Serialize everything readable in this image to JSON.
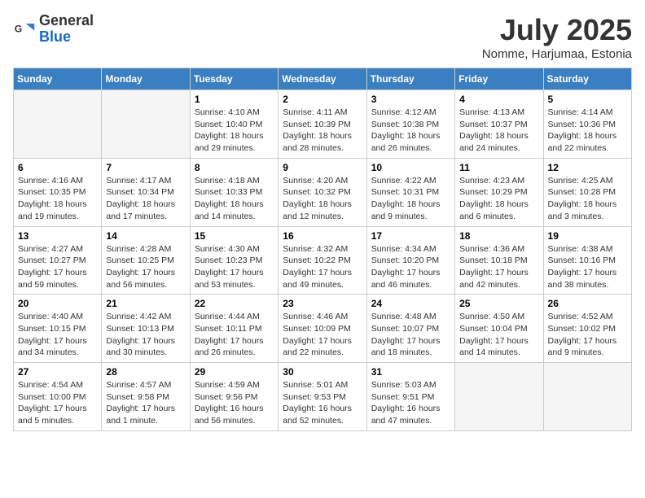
{
  "header": {
    "logo_general": "General",
    "logo_blue": "Blue",
    "month_year": "July 2025",
    "location": "Nomme, Harjumaa, Estonia"
  },
  "days_of_week": [
    "Sunday",
    "Monday",
    "Tuesday",
    "Wednesday",
    "Thursday",
    "Friday",
    "Saturday"
  ],
  "weeks": [
    [
      {
        "day": "",
        "info": ""
      },
      {
        "day": "",
        "info": ""
      },
      {
        "day": "1",
        "info": "Sunrise: 4:10 AM\nSunset: 10:40 PM\nDaylight: 18 hours\nand 29 minutes."
      },
      {
        "day": "2",
        "info": "Sunrise: 4:11 AM\nSunset: 10:39 PM\nDaylight: 18 hours\nand 28 minutes."
      },
      {
        "day": "3",
        "info": "Sunrise: 4:12 AM\nSunset: 10:38 PM\nDaylight: 18 hours\nand 26 minutes."
      },
      {
        "day": "4",
        "info": "Sunrise: 4:13 AM\nSunset: 10:37 PM\nDaylight: 18 hours\nand 24 minutes."
      },
      {
        "day": "5",
        "info": "Sunrise: 4:14 AM\nSunset: 10:36 PM\nDaylight: 18 hours\nand 22 minutes."
      }
    ],
    [
      {
        "day": "6",
        "info": "Sunrise: 4:16 AM\nSunset: 10:35 PM\nDaylight: 18 hours\nand 19 minutes."
      },
      {
        "day": "7",
        "info": "Sunrise: 4:17 AM\nSunset: 10:34 PM\nDaylight: 18 hours\nand 17 minutes."
      },
      {
        "day": "8",
        "info": "Sunrise: 4:18 AM\nSunset: 10:33 PM\nDaylight: 18 hours\nand 14 minutes."
      },
      {
        "day": "9",
        "info": "Sunrise: 4:20 AM\nSunset: 10:32 PM\nDaylight: 18 hours\nand 12 minutes."
      },
      {
        "day": "10",
        "info": "Sunrise: 4:22 AM\nSunset: 10:31 PM\nDaylight: 18 hours\nand 9 minutes."
      },
      {
        "day": "11",
        "info": "Sunrise: 4:23 AM\nSunset: 10:29 PM\nDaylight: 18 hours\nand 6 minutes."
      },
      {
        "day": "12",
        "info": "Sunrise: 4:25 AM\nSunset: 10:28 PM\nDaylight: 18 hours\nand 3 minutes."
      }
    ],
    [
      {
        "day": "13",
        "info": "Sunrise: 4:27 AM\nSunset: 10:27 PM\nDaylight: 17 hours\nand 59 minutes."
      },
      {
        "day": "14",
        "info": "Sunrise: 4:28 AM\nSunset: 10:25 PM\nDaylight: 17 hours\nand 56 minutes."
      },
      {
        "day": "15",
        "info": "Sunrise: 4:30 AM\nSunset: 10:23 PM\nDaylight: 17 hours\nand 53 minutes."
      },
      {
        "day": "16",
        "info": "Sunrise: 4:32 AM\nSunset: 10:22 PM\nDaylight: 17 hours\nand 49 minutes."
      },
      {
        "day": "17",
        "info": "Sunrise: 4:34 AM\nSunset: 10:20 PM\nDaylight: 17 hours\nand 46 minutes."
      },
      {
        "day": "18",
        "info": "Sunrise: 4:36 AM\nSunset: 10:18 PM\nDaylight: 17 hours\nand 42 minutes."
      },
      {
        "day": "19",
        "info": "Sunrise: 4:38 AM\nSunset: 10:16 PM\nDaylight: 17 hours\nand 38 minutes."
      }
    ],
    [
      {
        "day": "20",
        "info": "Sunrise: 4:40 AM\nSunset: 10:15 PM\nDaylight: 17 hours\nand 34 minutes."
      },
      {
        "day": "21",
        "info": "Sunrise: 4:42 AM\nSunset: 10:13 PM\nDaylight: 17 hours\nand 30 minutes."
      },
      {
        "day": "22",
        "info": "Sunrise: 4:44 AM\nSunset: 10:11 PM\nDaylight: 17 hours\nand 26 minutes."
      },
      {
        "day": "23",
        "info": "Sunrise: 4:46 AM\nSunset: 10:09 PM\nDaylight: 17 hours\nand 22 minutes."
      },
      {
        "day": "24",
        "info": "Sunrise: 4:48 AM\nSunset: 10:07 PM\nDaylight: 17 hours\nand 18 minutes."
      },
      {
        "day": "25",
        "info": "Sunrise: 4:50 AM\nSunset: 10:04 PM\nDaylight: 17 hours\nand 14 minutes."
      },
      {
        "day": "26",
        "info": "Sunrise: 4:52 AM\nSunset: 10:02 PM\nDaylight: 17 hours\nand 9 minutes."
      }
    ],
    [
      {
        "day": "27",
        "info": "Sunrise: 4:54 AM\nSunset: 10:00 PM\nDaylight: 17 hours\nand 5 minutes."
      },
      {
        "day": "28",
        "info": "Sunrise: 4:57 AM\nSunset: 9:58 PM\nDaylight: 17 hours\nand 1 minute."
      },
      {
        "day": "29",
        "info": "Sunrise: 4:59 AM\nSunset: 9:56 PM\nDaylight: 16 hours\nand 56 minutes."
      },
      {
        "day": "30",
        "info": "Sunrise: 5:01 AM\nSunset: 9:53 PM\nDaylight: 16 hours\nand 52 minutes."
      },
      {
        "day": "31",
        "info": "Sunrise: 5:03 AM\nSunset: 9:51 PM\nDaylight: 16 hours\nand 47 minutes."
      },
      {
        "day": "",
        "info": ""
      },
      {
        "day": "",
        "info": ""
      }
    ]
  ]
}
